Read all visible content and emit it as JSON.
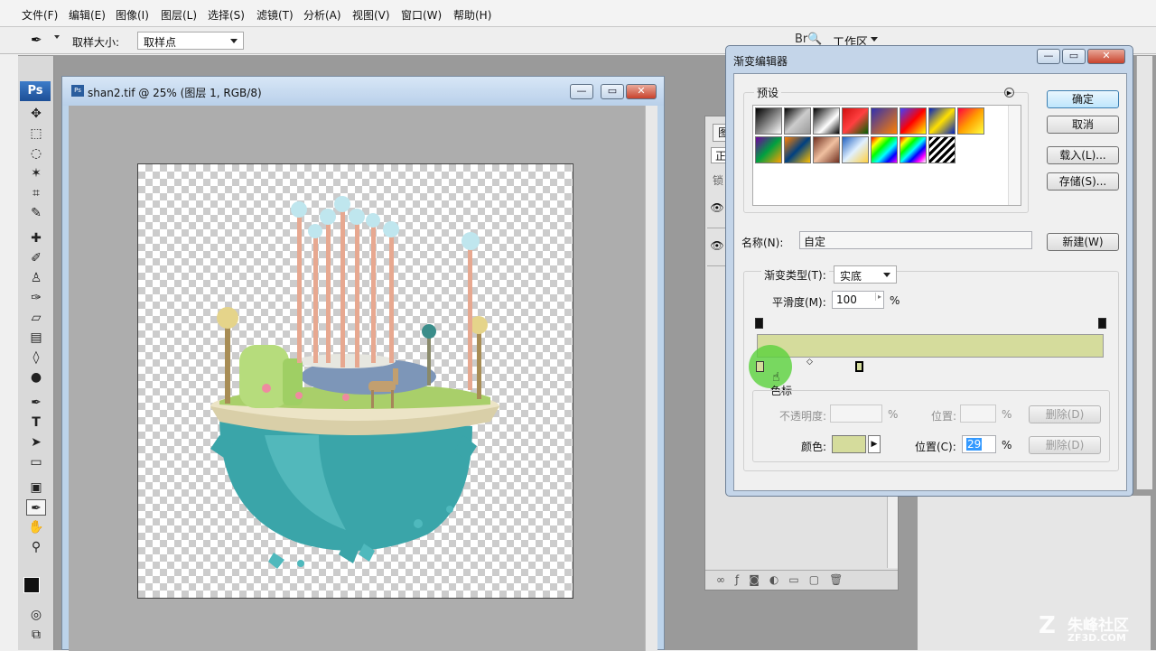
{
  "menu": [
    "文件(F)",
    "编辑(E)",
    "图像(I)",
    "图层(L)",
    "选择(S)",
    "滤镜(T)",
    "分析(A)",
    "视图(V)",
    "窗口(W)",
    "帮助(H)"
  ],
  "options": {
    "sample_size_label": "取样大小:",
    "sample_size_value": "取样点",
    "workspace_label": "工作区"
  },
  "tools_logo": "Ps",
  "document": {
    "title": "shan2.tif @ 25% (图层 1, RGB/8)"
  },
  "layers_panel": {
    "tab": "图",
    "blend_prefix": "正",
    "lock_prefix": "锁"
  },
  "dialog": {
    "title": "渐变编辑器",
    "presets_label": "预设",
    "buttons": {
      "ok": "确定",
      "cancel": "取消",
      "load": "载入(L)...",
      "save": "存储(S)...",
      "new": "新建(W)"
    },
    "name_label": "名称(N):",
    "name_value": "自定",
    "gradient_type_label": "渐变类型(T):",
    "gradient_type_value": "实底",
    "smoothness_label": "平滑度(M):",
    "smoothness_value": "100",
    "percent": "%",
    "stops_tooltip": "色标",
    "opacity_label": "不透明度:",
    "position_label_dis": "位置:",
    "delete_label": "删除(D)",
    "color_label": "颜色:",
    "position_label": "位置(C):",
    "position_value": "29",
    "gradient_color": "#d5dc9c"
  },
  "watermark": {
    "brand": "朱峰社区",
    "url": "ZF3D.COM"
  }
}
